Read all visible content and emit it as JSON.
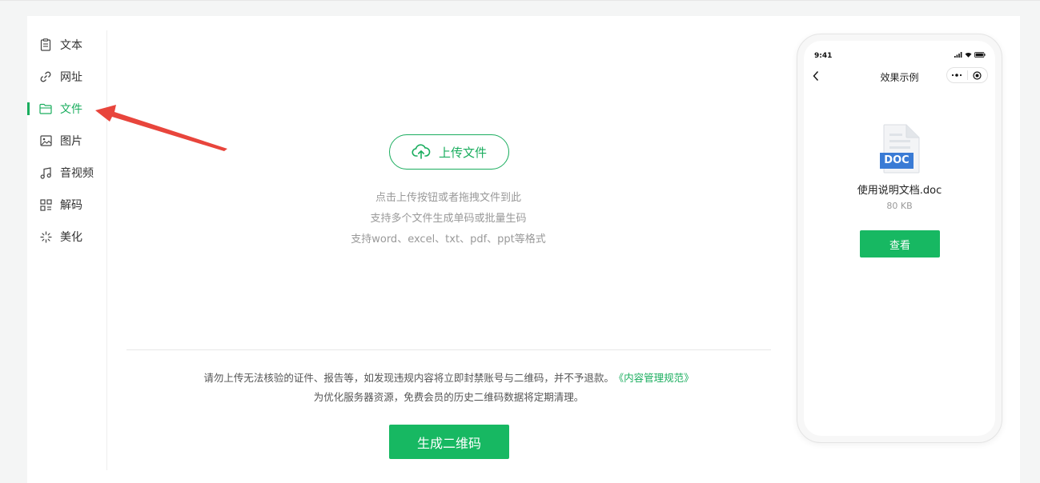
{
  "sidebar": {
    "items": [
      {
        "label": "文本",
        "icon": "document-icon",
        "active": false
      },
      {
        "label": "网址",
        "icon": "link-icon",
        "active": false
      },
      {
        "label": "文件",
        "icon": "folder-icon",
        "active": true
      },
      {
        "label": "图片",
        "icon": "image-icon",
        "active": false
      },
      {
        "label": "音视频",
        "icon": "music-icon",
        "active": false
      },
      {
        "label": "解码",
        "icon": "qr-grid-icon",
        "active": false
      },
      {
        "label": "美化",
        "icon": "sparkle-icon",
        "active": false
      }
    ]
  },
  "upload": {
    "button_label": "上传文件",
    "hints": [
      "点击上传按钮或者拖拽文件到此",
      "支持多个文件生成单码或批量生码",
      "支持word、excel、txt、pdf、ppt等格式"
    ]
  },
  "notice": {
    "line1": "请勿上传无法核验的证件、报告等，如发现违规内容将立即封禁账号与二维码，并不予退款。",
    "link": "《内容管理规范》",
    "line2": "为优化服务器资源，免费会员的历史二维码数据将定期清理。"
  },
  "generate_button": "生成二维码",
  "preview": {
    "time": "9:41",
    "title": "效果示例",
    "doc_badge": "DOC",
    "file_name": "使用说明文档.doc",
    "file_size": "80 KB",
    "view_button": "查看"
  },
  "colors": {
    "accent": "#1aad5e",
    "arrow": "#e8453c",
    "doc_badge": "#3a7bd5"
  }
}
